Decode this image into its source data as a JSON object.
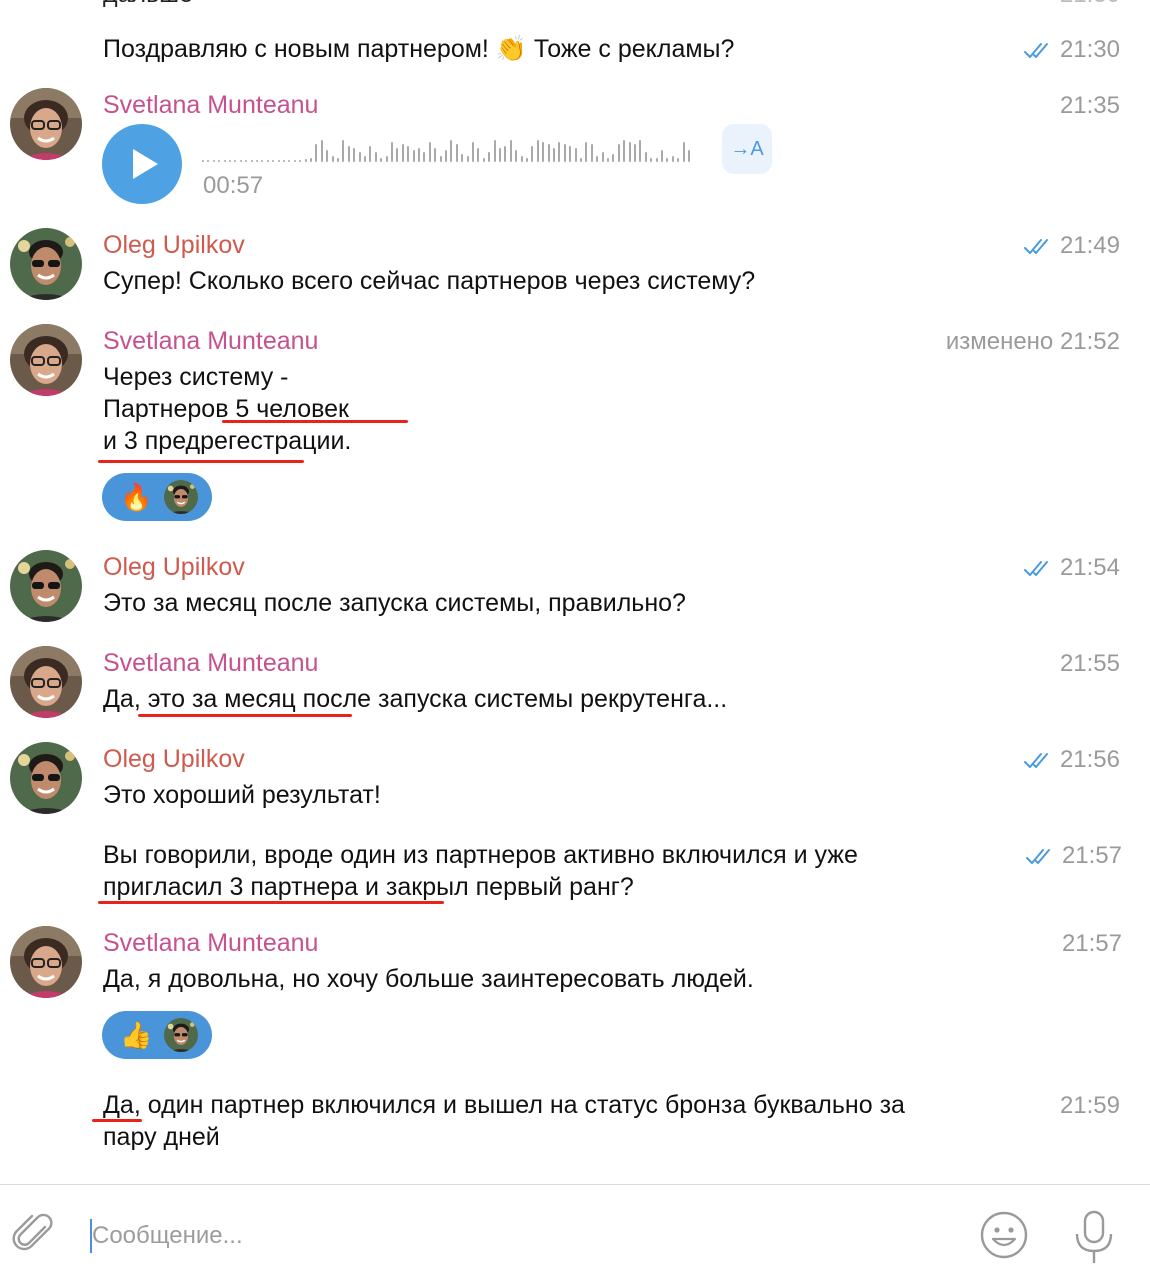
{
  "messages": {
    "m0": {
      "text": "Поздравляю с новым партнером! 👏 Тоже с рекламы?",
      "time": "21:30",
      "read": true
    },
    "m1": {
      "sender": "Svetlana Munteanu",
      "time": "21:35",
      "voice_duration": "00:57",
      "transcribe_label": "→A"
    },
    "m2": {
      "sender": "Oleg Upilkov",
      "time": "21:49",
      "text": "Супер! Сколько всего сейчас партнеров через систему?"
    },
    "m3": {
      "sender": "Svetlana Munteanu",
      "time": "изменено 21:52",
      "line1": "Через систему -",
      "line2": "Партнеров 5 человек",
      "line3": "и 3 предрегестрации.",
      "reaction_emoji": "🔥"
    },
    "m4": {
      "sender": "Oleg Upilkov",
      "time": "21:54",
      "text": "Это за месяц после запуска системы, правильно?"
    },
    "m5": {
      "sender": "Svetlana Munteanu",
      "time": "21:55",
      "text": "Да, это за месяц после запуска системы рекрутенга..."
    },
    "m6": {
      "sender": "Oleg Upilkov",
      "time": "21:56",
      "text": "Это хороший результат!"
    },
    "m7": {
      "time": "21:57",
      "line1": "Вы говорили, вроде один из партнеров активно включился и уже",
      "line2": "пригласил 3 партнера и закрыл первый ранг?"
    },
    "m8": {
      "sender": "Svetlana Munteanu",
      "time": "21:57",
      "text": "Да, я довольна, но хочу больше заинтересовать людей.",
      "reaction_emoji": "👍"
    },
    "m9": {
      "time": "21:59",
      "line1": "Да, один партнер включился и вышел на статус бронза буквально за",
      "line2": "пару дней"
    }
  },
  "composer": {
    "placeholder": "Сообщение..."
  },
  "colors": {
    "accent": "#4ea1e2",
    "svetlana_name": "#c6518f",
    "oleg_name": "#cf5a4e",
    "highlight": "#e8241a"
  },
  "icons": [
    "attach-icon",
    "emoji-icon",
    "microphone-icon",
    "double-check-icon",
    "play-icon"
  ]
}
